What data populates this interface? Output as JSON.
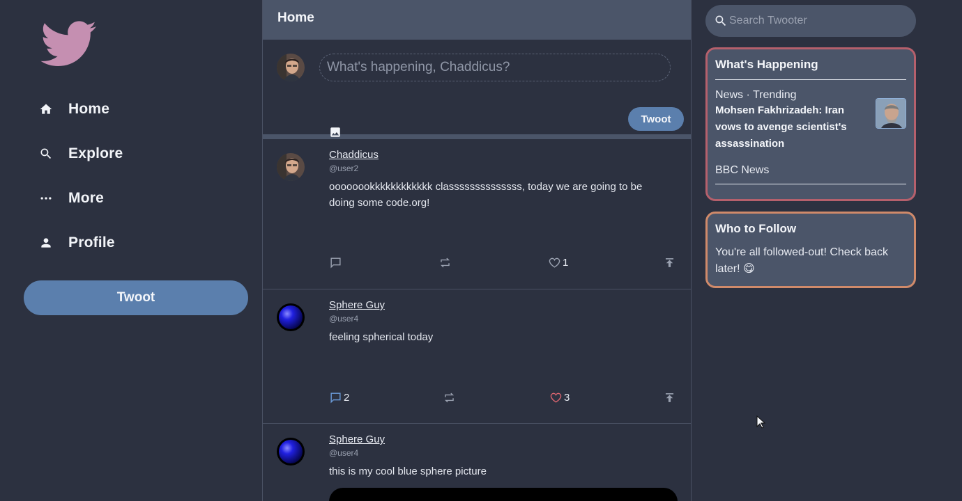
{
  "sidebar": {
    "logo_icon": "bird-logo",
    "items": [
      {
        "label": "Home",
        "icon": "home-icon"
      },
      {
        "label": "Explore",
        "icon": "search-icon"
      },
      {
        "label": "More",
        "icon": "more-icon"
      },
      {
        "label": "Profile",
        "icon": "person-icon"
      }
    ],
    "twoot_label": "Twoot"
  },
  "feed": {
    "title": "Home",
    "composer": {
      "placeholder": "What's happening, Chaddicus?",
      "twoot_label": "Twoot"
    },
    "posts": [
      {
        "name": "Chaddicus",
        "handle": "@user2",
        "text": "oooooookkkkkkkkkkkk classssssssssssss, today we are going to be doing some code.org!",
        "comments": "",
        "likes": "1",
        "liked": false,
        "commented": false
      },
      {
        "name": "Sphere Guy",
        "handle": "@user4",
        "text": "feeling spherical today",
        "comments": "2",
        "likes": "3",
        "liked": true,
        "commented": true
      },
      {
        "name": "Sphere Guy",
        "handle": "@user4",
        "text": "this is my cool blue sphere picture"
      }
    ]
  },
  "right": {
    "search_placeholder": "Search Twooter",
    "happening": {
      "title": "What's Happening",
      "trend_meta": "News · Trending",
      "trend_title": "Mohsen Fakhrizadeh: Iran vows to avenge scientist's assassination",
      "trend_source": "BBC News"
    },
    "follow": {
      "title": "Who to Follow",
      "text": "You're all followed-out! Check back later! 😋"
    }
  },
  "colors": {
    "background": "#2c3140",
    "panel": "#4b5569",
    "accent": "#5b7fad",
    "logo": "#c58fb1",
    "like": "#d9646f",
    "comment": "#6a9ad8",
    "happening_border": "#b5606c",
    "follow_border": "#d08a6a"
  }
}
